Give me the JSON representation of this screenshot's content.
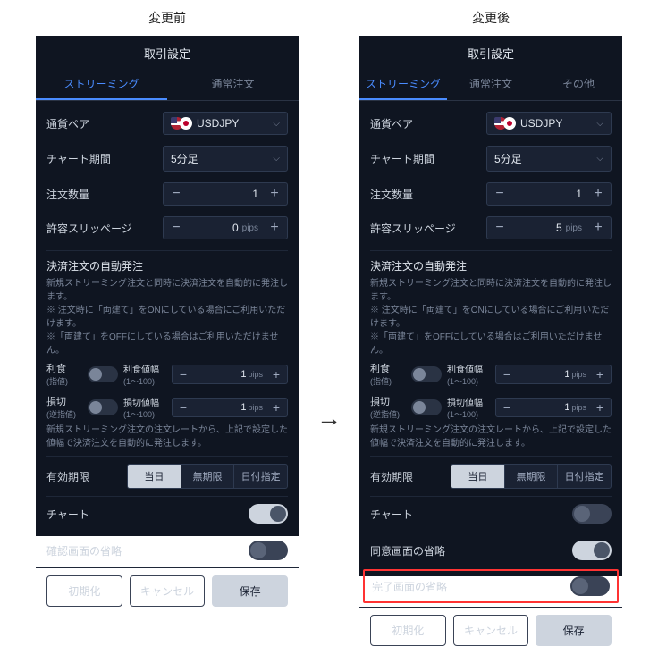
{
  "comparison": {
    "before_title": "変更前",
    "after_title": "変更後"
  },
  "panels": {
    "before": {
      "header": "取引設定",
      "tabs": [
        {
          "label": "ストリーミング",
          "active": true
        },
        {
          "label": "通常注文",
          "active": false
        }
      ],
      "currency_pair": {
        "label": "通貨ペア",
        "value": "USDJPY"
      },
      "chart_period": {
        "label": "チャート期間",
        "value": "5分足"
      },
      "order_qty": {
        "label": "注文数量",
        "value": "1"
      },
      "slippage": {
        "label": "許容スリッページ",
        "value": "0",
        "unit": "pips"
      },
      "auto_settle": {
        "title": "決済注文の自動発注",
        "desc": "新規ストリーミング注文と同時に決済注文を自動的に発注します。",
        "note1": "※ 注文時に「両建て」をONにしている場合にご利用いただけます。",
        "note2": "※「両建て」をOFFにしている場合はご利用いただけません。"
      },
      "tp": {
        "label": "利食",
        "sub": "(指値)",
        "width_label": "利食値幅",
        "range": "(1〜100)",
        "value": "1",
        "unit": "pips"
      },
      "sl": {
        "label": "損切",
        "sub": "(逆指値)",
        "width_label": "損切値幅",
        "range": "(1〜100)",
        "value": "1",
        "unit": "pips"
      },
      "auto_note": "新規ストリーミング注文の注文レートから、上記で設定した値幅で決済注文を自動的に発注します。",
      "expiry": {
        "label": "有効期限",
        "options": [
          "当日",
          "無期限",
          "日付指定"
        ],
        "selected": 0
      },
      "chart_toggle": {
        "label": "チャート",
        "on": true
      },
      "confirm_skip": {
        "label": "確認画面の省略",
        "on": false
      },
      "footer": {
        "reset": "初期化",
        "cancel": "キャンセル",
        "save": "保存"
      }
    },
    "after": {
      "header": "取引設定",
      "tabs": [
        {
          "label": "ストリーミング",
          "active": true
        },
        {
          "label": "通常注文",
          "active": false
        },
        {
          "label": "その他",
          "active": false
        }
      ],
      "currency_pair": {
        "label": "通貨ペア",
        "value": "USDJPY"
      },
      "chart_period": {
        "label": "チャート期間",
        "value": "5分足"
      },
      "order_qty": {
        "label": "注文数量",
        "value": "1"
      },
      "slippage": {
        "label": "許容スリッページ",
        "value": "5",
        "unit": "pips"
      },
      "auto_settle": {
        "title": "決済注文の自動発注",
        "desc": "新規ストリーミング注文と同時に決済注文を自動的に発注します。",
        "note1": "※ 注文時に「両建て」をONにしている場合にご利用いただけます。",
        "note2": "※「両建て」をOFFにしている場合はご利用いただけません。"
      },
      "tp": {
        "label": "利食",
        "sub": "(指値)",
        "width_label": "利食値幅",
        "range": "(1〜100)",
        "value": "1",
        "unit": "pips"
      },
      "sl": {
        "label": "損切",
        "sub": "(逆指値)",
        "width_label": "損切値幅",
        "range": "(1〜100)",
        "value": "1",
        "unit": "pips"
      },
      "auto_note": "新規ストリーミング注文の注文レートから、上記で設定した値幅で決済注文を自動的に発注します。",
      "expiry": {
        "label": "有効期限",
        "options": [
          "当日",
          "無期限",
          "日付指定"
        ],
        "selected": 0
      },
      "chart_toggle": {
        "label": "チャート",
        "on": false
      },
      "consent_skip": {
        "label": "同意画面の省略",
        "on": true
      },
      "complete_skip": {
        "label": "完了画面の省略",
        "on": false
      },
      "footer": {
        "reset": "初期化",
        "cancel": "キャンセル",
        "save": "保存"
      }
    }
  }
}
